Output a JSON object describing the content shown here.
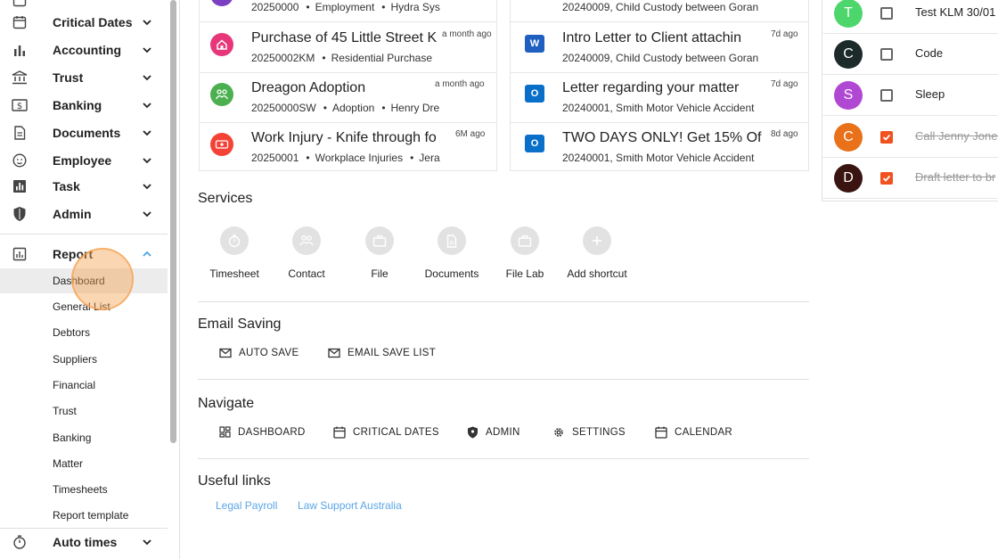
{
  "sidebar": {
    "items": [
      {
        "label": "Critical Dates",
        "icon": "calendar-icon"
      },
      {
        "label": "Accounting",
        "icon": "bar-chart-icon"
      },
      {
        "label": "Trust",
        "icon": "bank-icon"
      },
      {
        "label": "Banking",
        "icon": "dollar-icon"
      },
      {
        "label": "Documents",
        "icon": "document-icon"
      },
      {
        "label": "Employee",
        "icon": "face-icon"
      },
      {
        "label": "Task",
        "icon": "task-chart-icon"
      },
      {
        "label": "Admin",
        "icon": "shield-icon"
      }
    ],
    "report": {
      "label": "Report",
      "icon": "report-icon",
      "subitems": [
        "Dashboard",
        "General List",
        "Debtors",
        "Suppliers",
        "Financial",
        "Trust",
        "Banking",
        "Matter",
        "Timesheets",
        "Report template"
      ],
      "active": "Dashboard"
    },
    "auto_times": {
      "label": "Auto times",
      "icon": "stopwatch-icon"
    }
  },
  "matters": [
    {
      "title": "",
      "number": "20250000",
      "type": "Employment",
      "client": "Hydra Sys",
      "time": "",
      "icon_color": "#7b3fc4"
    },
    {
      "title": "Purchase of 45 Little Street K",
      "number": "20250002KM",
      "type": "Residential Purchase",
      "client": "",
      "time": "a month ago",
      "icon_color": "#e8367a"
    },
    {
      "title": "Dreagon Adoption",
      "number": "20250000SW",
      "type": "Adoption",
      "client": "Henry Dre",
      "time": "a month ago",
      "icon_color": "#4caf50"
    },
    {
      "title": "Work Injury - Knife through fo",
      "number": "20250001",
      "type": "Workplace Injuries",
      "client": "Jera",
      "time": "6M ago",
      "icon_color": "#f44336"
    }
  ],
  "documents": [
    {
      "title": "",
      "sub": "20240009, Child Custody between Goran",
      "time": "",
      "app": "outlook"
    },
    {
      "title": "Intro Letter to Client attachin",
      "sub": "20240009, Child Custody between Goran",
      "time": "7d ago",
      "app": "word"
    },
    {
      "title": "Letter regarding your matter",
      "sub": "20240001, Smith Motor Vehicle Accident",
      "time": "7d ago",
      "app": "outlook"
    },
    {
      "title": "TWO DAYS ONLY! Get 15% Of",
      "sub": "20240001, Smith Motor Vehicle Accident",
      "time": "8d ago",
      "app": "outlook"
    }
  ],
  "services": {
    "title": "Services",
    "items": [
      {
        "label": "Timesheet",
        "icon": "stopwatch-icon"
      },
      {
        "label": "Contact",
        "icon": "contacts-icon"
      },
      {
        "label": "File",
        "icon": "briefcase-icon"
      },
      {
        "label": "Documents",
        "icon": "document-icon"
      },
      {
        "label": "File Lab",
        "icon": "briefcase-icon"
      },
      {
        "label": "Add shortcut",
        "icon": "plus-icon"
      }
    ]
  },
  "email_saving": {
    "title": "Email Saving",
    "actions": [
      "AUTO SAVE",
      "EMAIL SAVE LIST"
    ]
  },
  "navigate": {
    "title": "Navigate",
    "actions": [
      "DASHBOARD",
      "CRITICAL DATES",
      "ADMIN",
      "SETTINGS",
      "CALENDAR"
    ]
  },
  "useful_links": {
    "title": "Useful links",
    "links": [
      "Legal Payroll",
      "Law Support Australia"
    ]
  },
  "tasks": [
    {
      "initial": "T",
      "color": "#4cd66b",
      "text": "Test KLM 30/01",
      "done": false
    },
    {
      "initial": "C",
      "color": "#1c2a2a",
      "text": "Code",
      "done": false
    },
    {
      "initial": "S",
      "color": "#b048d4",
      "text": "Sleep",
      "done": false
    },
    {
      "initial": "C",
      "color": "#e8711a",
      "text": "Call Jenny Jones",
      "done": true
    },
    {
      "initial": "D",
      "color": "#3a1410",
      "text": "Draft letter to br",
      "done": true
    }
  ]
}
